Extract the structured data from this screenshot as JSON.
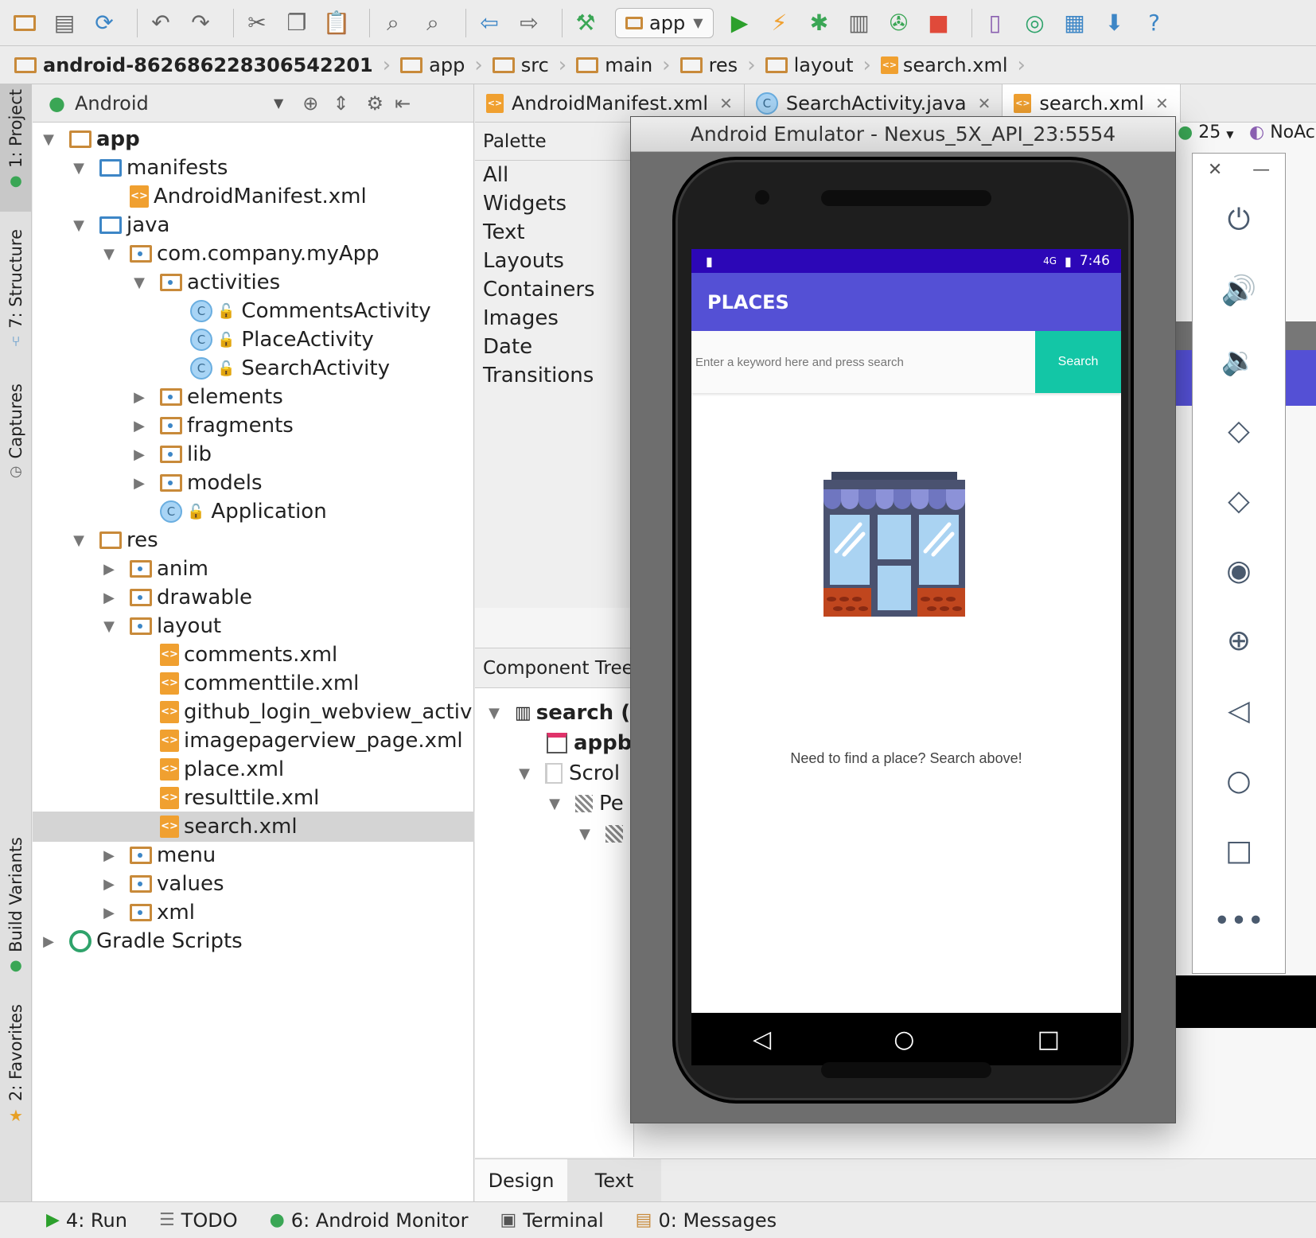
{
  "toolbar": {
    "run_config": "app"
  },
  "breadcrumb": [
    "android-862686228306542201",
    "app",
    "src",
    "main",
    "res",
    "layout",
    "search.xml"
  ],
  "left_strip": {
    "project": "1: Project",
    "structure": "7: Structure",
    "captures": "Captures",
    "build_variants": "Build Variants",
    "favorites": "2: Favorites"
  },
  "project_panel": {
    "view": "Android",
    "tree": [
      {
        "label": "app",
        "depth": 0,
        "icon": "folder",
        "arrow": "open",
        "bold": true
      },
      {
        "label": "manifests",
        "depth": 1,
        "icon": "srcfolder",
        "arrow": "open"
      },
      {
        "label": "AndroidManifest.xml",
        "depth": 2,
        "icon": "xml",
        "arrow": ""
      },
      {
        "label": "java",
        "depth": 1,
        "icon": "srcfolder",
        "arrow": "open"
      },
      {
        "label": "com.company.myApp",
        "depth": 2,
        "icon": "pkg",
        "arrow": "open"
      },
      {
        "label": "activities",
        "depth": 3,
        "icon": "pkg",
        "arrow": "open"
      },
      {
        "label": "CommentsActivity",
        "depth": 4,
        "icon": "cls",
        "arrow": ""
      },
      {
        "label": "PlaceActivity",
        "depth": 4,
        "icon": "cls",
        "arrow": ""
      },
      {
        "label": "SearchActivity",
        "depth": 4,
        "icon": "cls",
        "arrow": ""
      },
      {
        "label": "elements",
        "depth": 3,
        "icon": "pkg",
        "arrow": "closed"
      },
      {
        "label": "fragments",
        "depth": 3,
        "icon": "pkg",
        "arrow": "closed"
      },
      {
        "label": "lib",
        "depth": 3,
        "icon": "pkg",
        "arrow": "closed"
      },
      {
        "label": "models",
        "depth": 3,
        "icon": "pkg",
        "arrow": "closed"
      },
      {
        "label": "Application",
        "depth": 3,
        "icon": "cls",
        "arrow": ""
      },
      {
        "label": "res",
        "depth": 1,
        "icon": "folder",
        "arrow": "open"
      },
      {
        "label": "anim",
        "depth": 2,
        "icon": "pkg",
        "arrow": "closed"
      },
      {
        "label": "drawable",
        "depth": 2,
        "icon": "pkg",
        "arrow": "closed"
      },
      {
        "label": "layout",
        "depth": 2,
        "icon": "pkg",
        "arrow": "open"
      },
      {
        "label": "comments.xml",
        "depth": 3,
        "icon": "xml",
        "arrow": ""
      },
      {
        "label": "commenttile.xml",
        "depth": 3,
        "icon": "xml",
        "arrow": ""
      },
      {
        "label": "github_login_webview_activ",
        "depth": 3,
        "icon": "xml",
        "arrow": ""
      },
      {
        "label": "imagepagerview_page.xml",
        "depth": 3,
        "icon": "xml",
        "arrow": ""
      },
      {
        "label": "place.xml",
        "depth": 3,
        "icon": "xml",
        "arrow": ""
      },
      {
        "label": "resulttile.xml",
        "depth": 3,
        "icon": "xml",
        "arrow": ""
      },
      {
        "label": "search.xml",
        "depth": 3,
        "icon": "xml",
        "arrow": "",
        "selected": true
      },
      {
        "label": "menu",
        "depth": 2,
        "icon": "pkg",
        "arrow": "closed"
      },
      {
        "label": "values",
        "depth": 2,
        "icon": "pkg",
        "arrow": "closed"
      },
      {
        "label": "xml",
        "depth": 2,
        "icon": "pkg",
        "arrow": "closed"
      },
      {
        "label": "Gradle Scripts",
        "depth": 0,
        "icon": "gradle",
        "arrow": "closed"
      }
    ]
  },
  "editor_tabs": [
    {
      "label": "AndroidManifest.xml",
      "icon": "xml"
    },
    {
      "label": "SearchActivity.java",
      "icon": "cls"
    },
    {
      "label": "search.xml",
      "icon": "xml",
      "active": true
    }
  ],
  "palette": {
    "title": "Palette",
    "items": [
      "All",
      "Widgets",
      "Text",
      "Layouts",
      "Containers",
      "Images",
      "Date",
      "Transitions"
    ]
  },
  "component_tree": {
    "title": "Component Tree",
    "items": [
      "search (",
      "appb",
      "Scrol",
      "Pe"
    ]
  },
  "design_tabs": {
    "design": "Design",
    "text": "Text"
  },
  "status_bar": {
    "run": "4: Run",
    "todo": "TODO",
    "monitor": "6: Android Monitor",
    "terminal": "Terminal",
    "messages": "0: Messages"
  },
  "emulator": {
    "title": "Android Emulator - Nexus_5X_API_23:5554",
    "status_time": "7:46",
    "network": "4G",
    "app_title": "PLACES",
    "search_placeholder": "Enter a keyword here and press search",
    "search_button": "Search",
    "empty_message": "Need to find a place? Search above!"
  },
  "right_hints": {
    "api": "25",
    "theme": "NoAc"
  },
  "colors": {
    "status_bar": "#2c07b7",
    "app_bar": "#5450d5",
    "search_button": "#13c6a6"
  }
}
